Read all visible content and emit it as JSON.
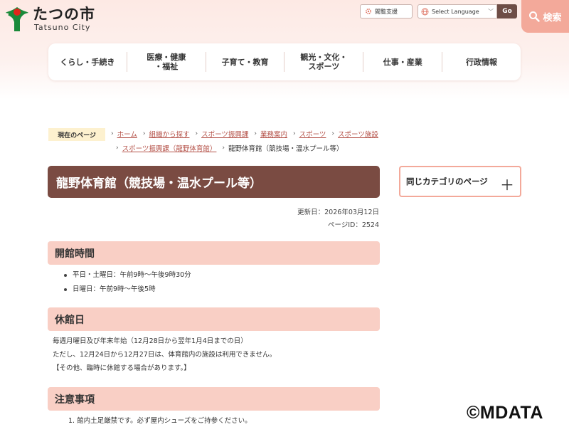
{
  "header": {
    "logo_ja": "たつの市",
    "logo_en": "Tatsuno City",
    "read_support": "閲覧支援",
    "language_select": "Select Language",
    "go": "Go",
    "search": "検索"
  },
  "nav": {
    "items": [
      "くらし・手続き",
      "医療・健康\n・福祉",
      "子育て・教育",
      "観光・文化・\nスポーツ",
      "仕事・産業",
      "行政情報"
    ]
  },
  "breadcrumb": {
    "label": "現在のページ",
    "links": [
      "ホーム",
      "組織から探す",
      "スポーツ振興課",
      "業務案内",
      "スポーツ",
      "スポーツ施設",
      "スポーツ振興課（龍野体育館）"
    ],
    "current": "龍野体育館（競技場・温水プール等）"
  },
  "page": {
    "title": "龍野体育館（競技場・温水プール等）",
    "updated": "更新日：2026年03月12日",
    "page_id": "ページID：2524"
  },
  "sidebar": {
    "same_category": "同じカテゴリのページ"
  },
  "sections": {
    "hours": {
      "heading": "開館時間",
      "items": [
        "平日・土曜日：午前9時～午後9時30分",
        "日曜日：午前9時～午後5時"
      ]
    },
    "closed": {
      "heading": "休館日",
      "lines": [
        "毎週月曜日及び年末年始（12月28日から翌年1月4日までの日）",
        "ただし、12月24日から12月27日は、体育館内の施設は利用できません。",
        "【その他、臨時に休館する場合があります。】"
      ]
    },
    "notes": {
      "heading": "注意事項",
      "items": [
        "1. 館内土足厳禁です。必ず屋内シューズをご持参ください。"
      ]
    }
  },
  "watermark": "©MDATA",
  "colors": {
    "brand_brown": "#7a4b42",
    "accent_pink": "#f3a99a",
    "heading_bg": "#f9cfc5",
    "link": "#b5534a"
  }
}
